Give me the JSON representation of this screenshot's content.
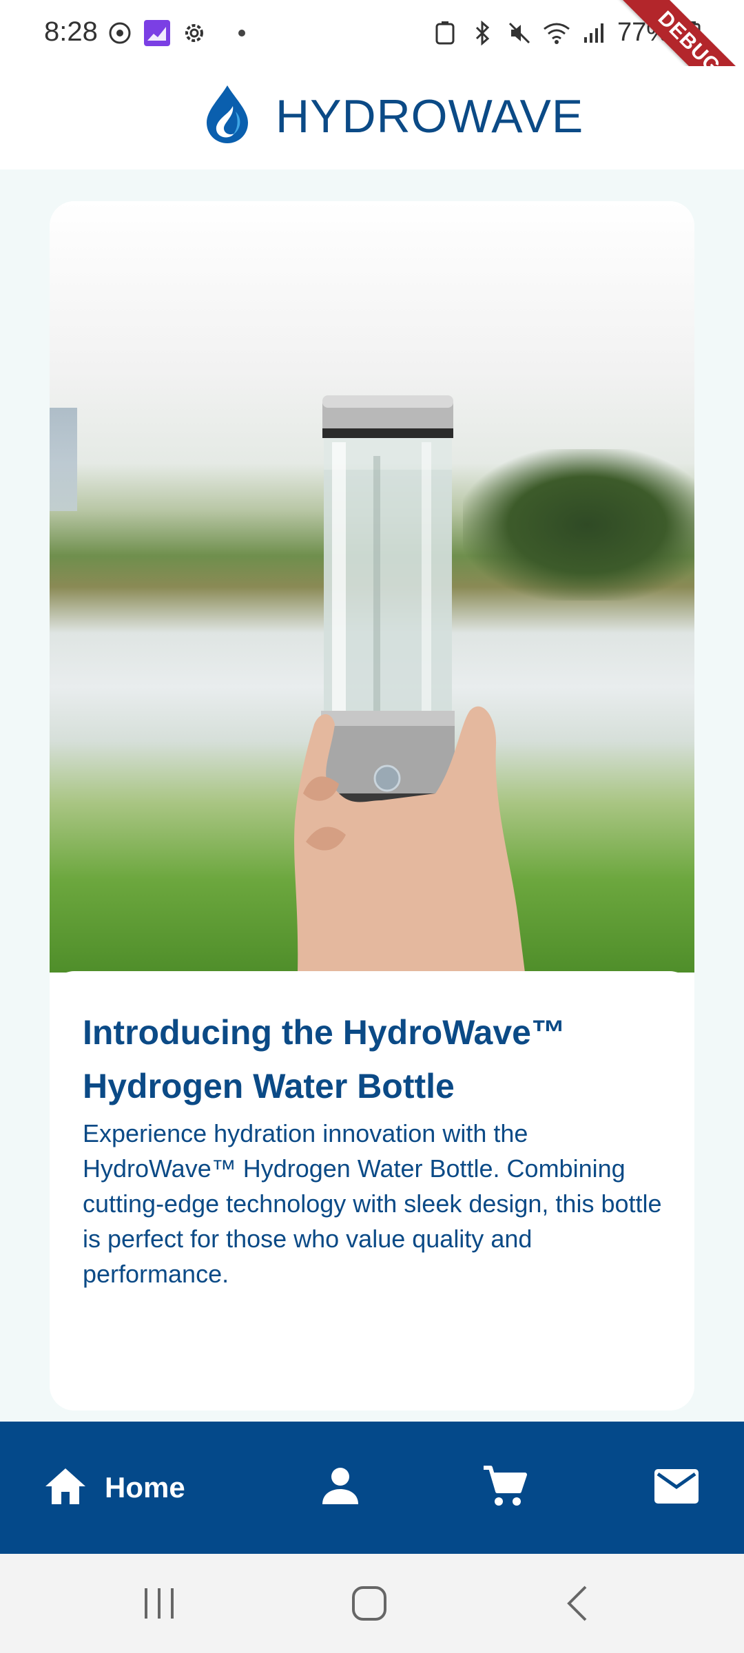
{
  "status_bar": {
    "time": "8:28",
    "battery": "77%",
    "left_icons": [
      "sync-icon",
      "chart-app-icon",
      "settings-gear-icon",
      "notification-dot"
    ],
    "right_icons": [
      "battery-saver-icon",
      "bluetooth-icon",
      "mute-icon",
      "wifi-icon",
      "signal-icon",
      "battery-icon"
    ]
  },
  "debug_banner": "DEBUG",
  "header": {
    "title": "HYDROWAVE",
    "logo": "water-drop-logo"
  },
  "card": {
    "image": "hydrogen-water-bottle-photo",
    "headline": "Introducing the HydroWave™ Hydrogen Water Bottle",
    "description": "Experience hydration innovation with the HydroWave™ Hydrogen Water Bottle. Combining cutting-edge technology with sleek design, this bottle is perfect for those who value quality and performance."
  },
  "bottom_nav": {
    "items": [
      {
        "label": "Home",
        "icon": "home-icon",
        "active": true
      },
      {
        "label": "",
        "icon": "person-icon",
        "active": false
      },
      {
        "label": "",
        "icon": "cart-icon",
        "active": false
      },
      {
        "label": "",
        "icon": "mail-icon",
        "active": false
      }
    ]
  },
  "colors": {
    "brand_blue": "#0b4a86",
    "nav_blue": "#04498a",
    "page_bg": "#f2f9f9",
    "debug_red": "#b3262b"
  },
  "system_nav": [
    "recents-button",
    "home-button",
    "back-button"
  ]
}
